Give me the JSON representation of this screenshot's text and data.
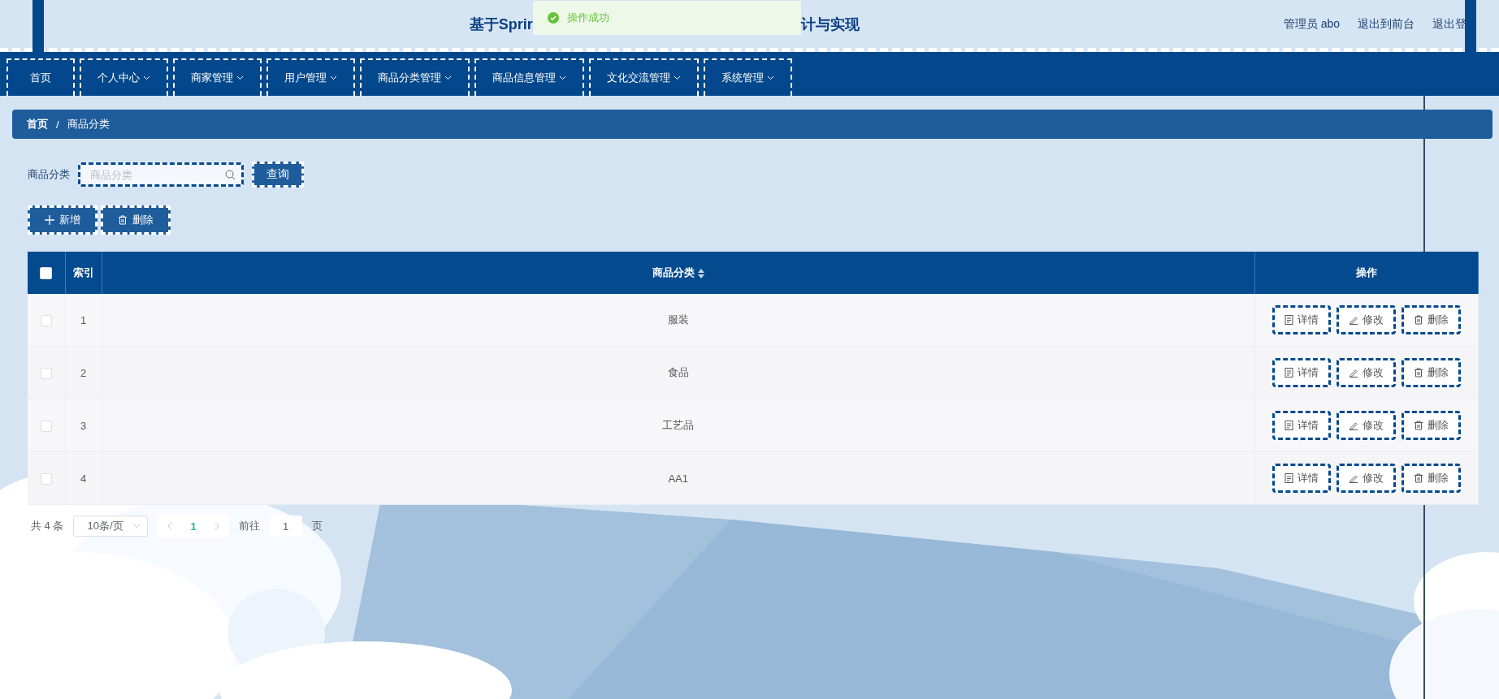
{
  "header": {
    "title_parts": [
      "基于Sprir",
      "计与实现"
    ],
    "toast": {
      "kind": "success",
      "message": "操作成功"
    },
    "user_links": [
      "管理员 abo",
      "退出到前台",
      "退出登"
    ]
  },
  "nav": [
    {
      "label": "首页",
      "dropdown": false
    },
    {
      "label": "个人中心",
      "dropdown": true
    },
    {
      "label": "商家管理",
      "dropdown": true
    },
    {
      "label": "用户管理",
      "dropdown": true
    },
    {
      "label": "商品分类管理",
      "dropdown": true
    },
    {
      "label": "商品信息管理",
      "dropdown": true
    },
    {
      "label": "文化交流管理",
      "dropdown": true
    },
    {
      "label": "系统管理",
      "dropdown": true
    }
  ],
  "breadcrumb": [
    "首页",
    "商品分类"
  ],
  "breadcrumb_separator": "/",
  "search": {
    "label": "商品分类",
    "placeholder": "商品分类",
    "button": "查询"
  },
  "toolbar": [
    {
      "kind": "add",
      "label": "新增"
    },
    {
      "kind": "delete",
      "label": "删除"
    }
  ],
  "table": {
    "select_all": {
      "checked": false
    },
    "columns": [
      {
        "kind": "index",
        "label": "索引",
        "sortable": false
      },
      {
        "kind": "text",
        "label": "商品分类",
        "sortable": true
      },
      {
        "kind": "actions",
        "label": "操作",
        "sortable": false
      }
    ],
    "rows": [
      {
        "checked": false,
        "index": "1",
        "category": "服装",
        "actions": [
          {
            "kind": "detail",
            "label": "详情"
          },
          {
            "kind": "edit",
            "label": "修改"
          },
          {
            "kind": "delete",
            "label": "删除"
          }
        ]
      },
      {
        "checked": false,
        "index": "2",
        "category": "食品",
        "actions": [
          {
            "kind": "detail",
            "label": "详情"
          },
          {
            "kind": "edit",
            "label": "修改"
          },
          {
            "kind": "delete",
            "label": "删除"
          }
        ]
      },
      {
        "checked": false,
        "index": "3",
        "category": "工艺品",
        "actions": [
          {
            "kind": "detail",
            "label": "详情"
          },
          {
            "kind": "edit",
            "label": "修改"
          },
          {
            "kind": "delete",
            "label": "删除"
          }
        ]
      },
      {
        "checked": false,
        "index": "4",
        "category": "AA1",
        "actions": [
          {
            "kind": "detail",
            "label": "详情"
          },
          {
            "kind": "edit",
            "label": "修改"
          },
          {
            "kind": "delete",
            "label": "删除"
          }
        ]
      }
    ]
  },
  "pagination": {
    "total": "共 4 条",
    "page_size": "10条/页",
    "pages": [
      {
        "label": "1",
        "selected": true
      }
    ],
    "goto_label": "前往",
    "goto_value": "1",
    "page_suffix": "页"
  }
}
